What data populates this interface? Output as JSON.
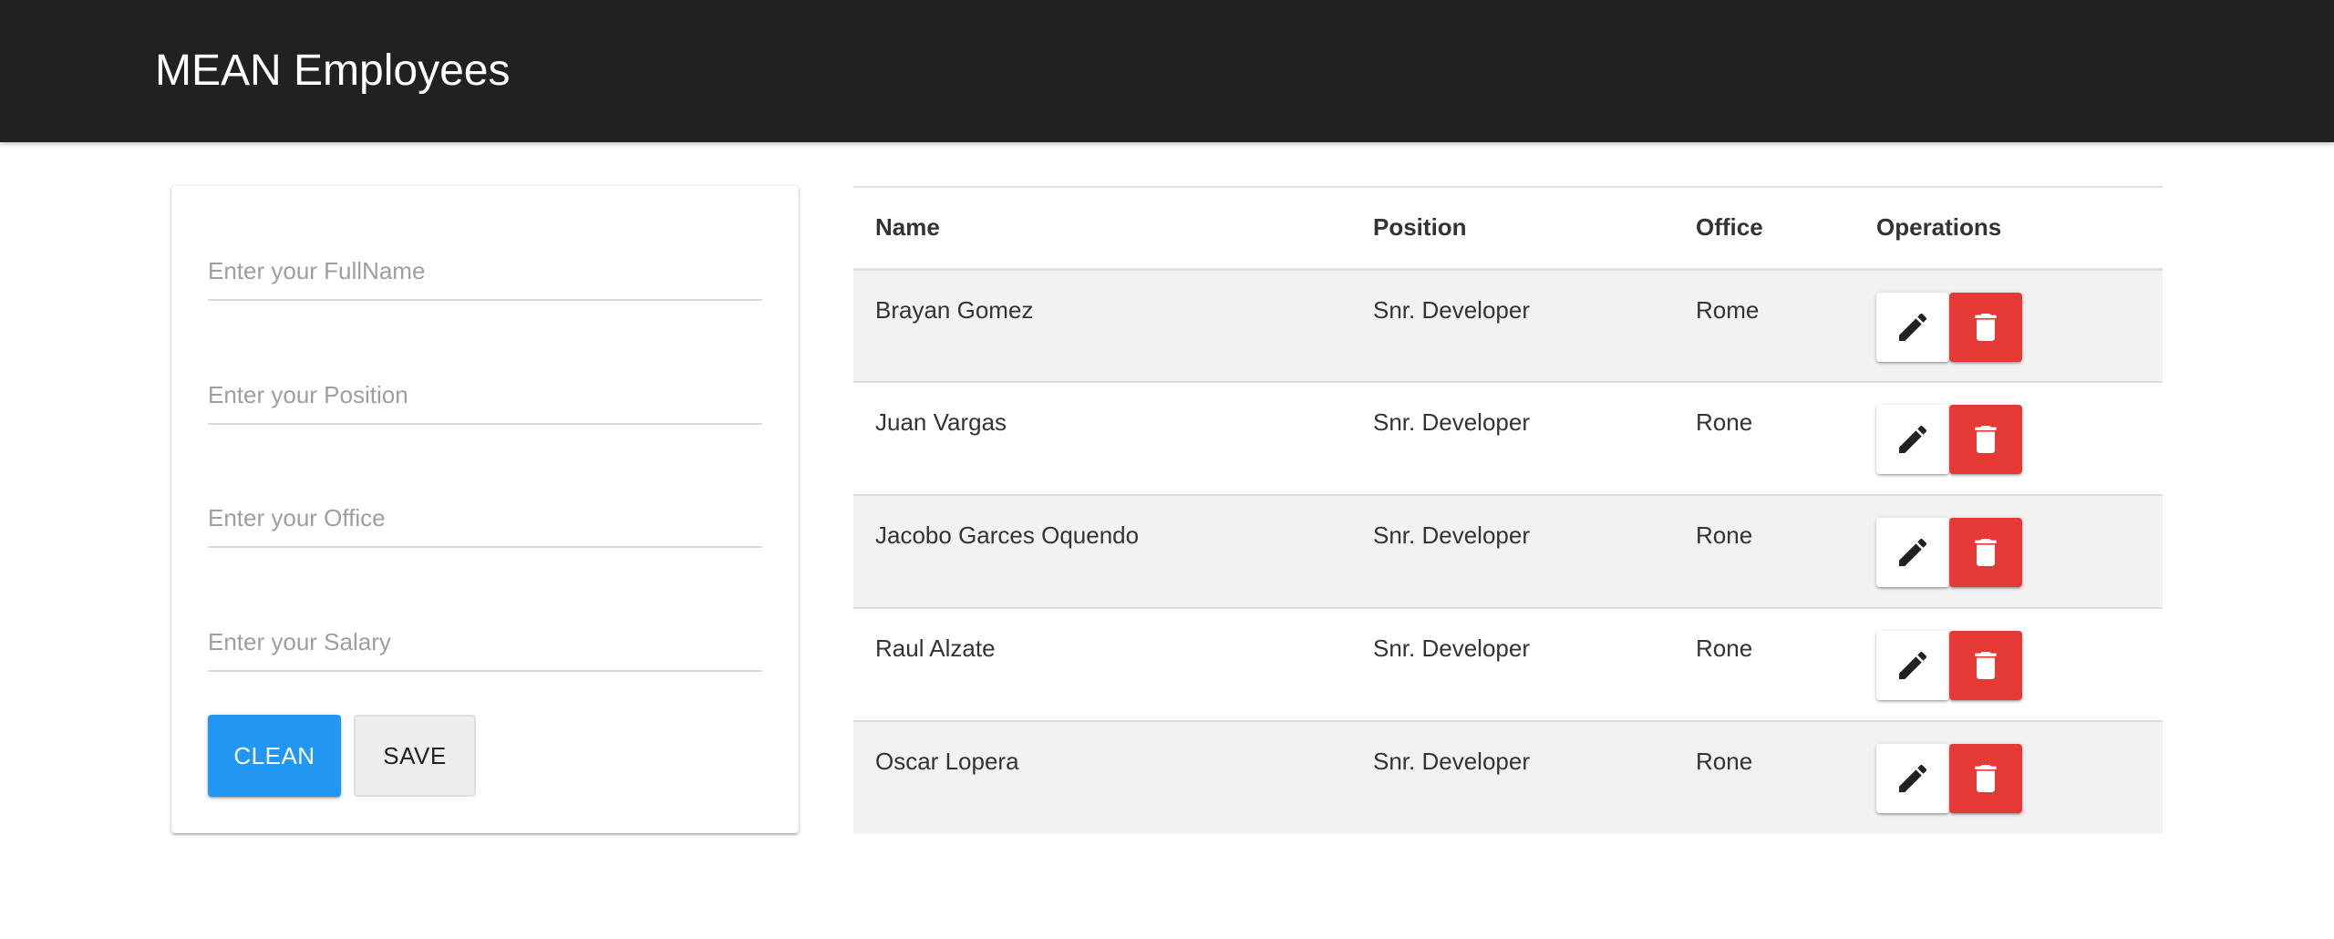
{
  "app": {
    "title": "MEAN Employees"
  },
  "form": {
    "fullname_placeholder": "Enter your FullName",
    "position_placeholder": "Enter your Position",
    "office_placeholder": "Enter your Office",
    "salary_placeholder": "Enter your Salary",
    "clean_label": "CLEAN",
    "save_label": "SAVE"
  },
  "table": {
    "headers": {
      "name": "Name",
      "position": "Position",
      "office": "Office",
      "operations": "Operations"
    },
    "rows": [
      {
        "name": "Brayan Gomez",
        "position": "Snr. Developer",
        "office": "Rome"
      },
      {
        "name": "Juan Vargas",
        "position": "Snr. Developer",
        "office": "Rone"
      },
      {
        "name": "Jacobo Garces Oquendo",
        "position": "Snr. Developer",
        "office": "Rone"
      },
      {
        "name": "Raul Alzate",
        "position": "Snr. Developer",
        "office": "Rone"
      },
      {
        "name": "Oscar Lopera",
        "position": "Snr. Developer",
        "office": "Rone"
      }
    ],
    "row_operations": {
      "edit_icon": "pencil-icon",
      "delete_icon": "trash-icon"
    }
  },
  "colors": {
    "navbar": "#212121",
    "primary": "#2196f3",
    "danger": "#e53935"
  }
}
